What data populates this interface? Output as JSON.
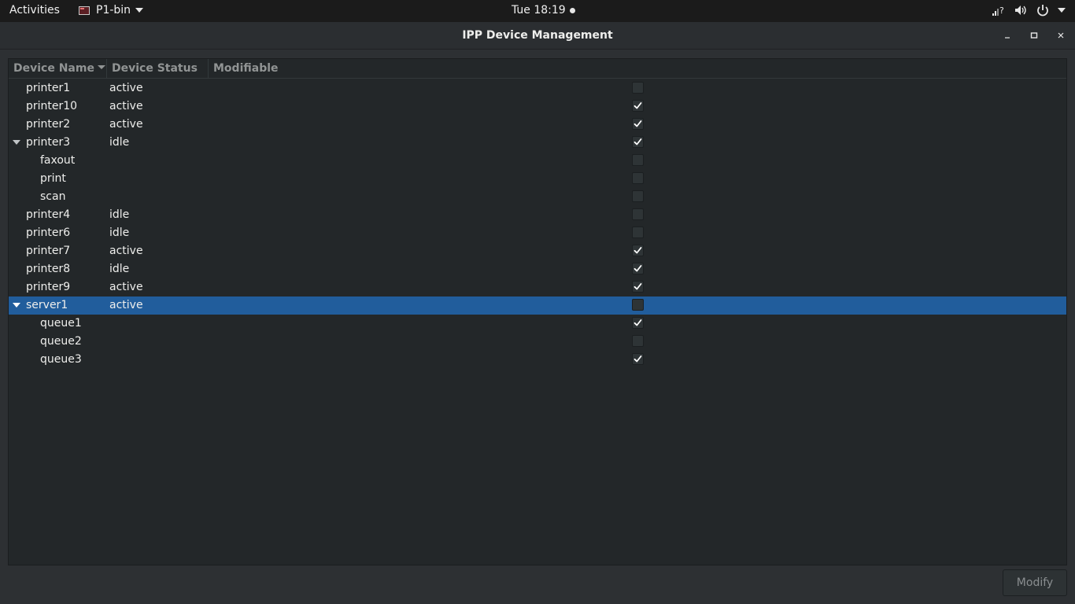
{
  "topbar": {
    "activities": "Activities",
    "app_name": "P1-bin",
    "clock": "Tue 18:19"
  },
  "window": {
    "title": "IPP Device Management"
  },
  "tree": {
    "columns": [
      "Device Name",
      "Device Status",
      "Modifiable"
    ],
    "sorted_column": "Device Name",
    "rows": [
      {
        "name": "printer1",
        "status": "active",
        "modifiable": false,
        "level": 0,
        "expanded": false,
        "selected": false
      },
      {
        "name": "printer10",
        "status": "active",
        "modifiable": true,
        "level": 0,
        "expanded": false,
        "selected": false
      },
      {
        "name": "printer2",
        "status": "active",
        "modifiable": true,
        "level": 0,
        "expanded": false,
        "selected": false
      },
      {
        "name": "printer3",
        "status": "idle",
        "modifiable": true,
        "level": 0,
        "expanded": true,
        "selected": false
      },
      {
        "name": "faxout",
        "status": "",
        "modifiable": false,
        "level": 1,
        "expanded": false,
        "selected": false
      },
      {
        "name": "print",
        "status": "",
        "modifiable": false,
        "level": 1,
        "expanded": false,
        "selected": false
      },
      {
        "name": "scan",
        "status": "",
        "modifiable": false,
        "level": 1,
        "expanded": false,
        "selected": false
      },
      {
        "name": "printer4",
        "status": "idle",
        "modifiable": false,
        "level": 0,
        "expanded": false,
        "selected": false
      },
      {
        "name": "printer6",
        "status": "idle",
        "modifiable": false,
        "level": 0,
        "expanded": false,
        "selected": false
      },
      {
        "name": "printer7",
        "status": "active",
        "modifiable": true,
        "level": 0,
        "expanded": false,
        "selected": false
      },
      {
        "name": "printer8",
        "status": "idle",
        "modifiable": true,
        "level": 0,
        "expanded": false,
        "selected": false
      },
      {
        "name": "printer9",
        "status": "active",
        "modifiable": true,
        "level": 0,
        "expanded": false,
        "selected": false
      },
      {
        "name": "server1",
        "status": "active",
        "modifiable": false,
        "level": 0,
        "expanded": true,
        "selected": true
      },
      {
        "name": "queue1",
        "status": "",
        "modifiable": true,
        "level": 1,
        "expanded": false,
        "selected": false
      },
      {
        "name": "queue2",
        "status": "",
        "modifiable": false,
        "level": 1,
        "expanded": false,
        "selected": false
      },
      {
        "name": "queue3",
        "status": "",
        "modifiable": true,
        "level": 1,
        "expanded": false,
        "selected": false
      }
    ]
  },
  "buttons": {
    "modify": "Modify"
  },
  "colors": {
    "selection": "#215d9c",
    "panel": "#1b1b1b",
    "window_bg": "#2d3033",
    "tree_bg": "#232729"
  },
  "icons": {
    "tray": [
      "network-question-icon",
      "volume-icon",
      "power-icon",
      "chevron-down-icon"
    ]
  }
}
